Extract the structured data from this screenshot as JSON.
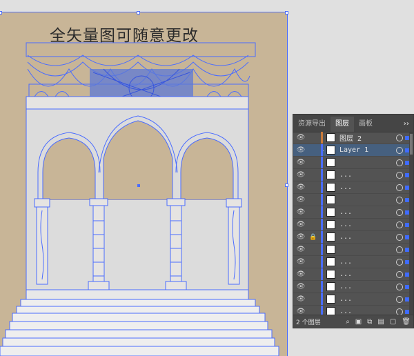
{
  "headline": "全矢量图可随意更改",
  "panel": {
    "tabs": [
      {
        "label": "资源导出",
        "active": false
      },
      {
        "label": "图层",
        "active": true
      },
      {
        "label": "画板",
        "active": false
      }
    ],
    "tab_menu": "››",
    "layers": [
      {
        "name": "图层 2",
        "thumb": true,
        "selected": false,
        "expand": "",
        "locked": false,
        "bar": "#c97a3a"
      },
      {
        "name": "Layer 1",
        "thumb": true,
        "selected": true,
        "expand": "⌄",
        "locked": false,
        "bar": "#4a6cff"
      },
      {
        "name": "",
        "thumb": true,
        "selected": false,
        "expand": "",
        "locked": false,
        "bar": "#4a6cff"
      },
      {
        "name": "...",
        "thumb": true,
        "selected": false,
        "expand": "›",
        "locked": false,
        "bar": "#4a6cff"
      },
      {
        "name": "...",
        "thumb": true,
        "selected": false,
        "expand": "›",
        "locked": false,
        "bar": "#4a6cff"
      },
      {
        "name": "",
        "thumb": true,
        "selected": false,
        "expand": "",
        "locked": false,
        "bar": "#4a6cff"
      },
      {
        "name": "...",
        "thumb": true,
        "selected": false,
        "expand": "›",
        "locked": false,
        "bar": "#4a6cff"
      },
      {
        "name": "...",
        "thumb": true,
        "selected": false,
        "expand": "›",
        "locked": false,
        "bar": "#4a6cff"
      },
      {
        "name": "...",
        "thumb": true,
        "selected": false,
        "expand": "›",
        "locked": true,
        "bar": "#4a6cff"
      },
      {
        "name": "",
        "thumb": true,
        "selected": false,
        "expand": "",
        "locked": false,
        "bar": "#4a6cff"
      },
      {
        "name": "...",
        "thumb": true,
        "selected": false,
        "expand": "›",
        "locked": false,
        "bar": "#4a6cff"
      },
      {
        "name": "...",
        "thumb": true,
        "selected": false,
        "expand": "›",
        "locked": false,
        "bar": "#4a6cff"
      },
      {
        "name": "...",
        "thumb": true,
        "selected": false,
        "expand": "›",
        "locked": false,
        "bar": "#4a6cff"
      },
      {
        "name": "...",
        "thumb": true,
        "selected": false,
        "expand": "›",
        "locked": false,
        "bar": "#4a6cff"
      },
      {
        "name": "...",
        "thumb": true,
        "selected": false,
        "expand": "›",
        "locked": false,
        "bar": "#4a6cff"
      }
    ],
    "layer_count": "2 个图层"
  },
  "colors": {
    "artboard": "#c8b597",
    "selection": "#4a6cff"
  }
}
